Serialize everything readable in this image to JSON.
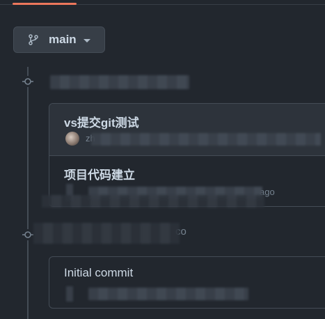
{
  "branch_selector": {
    "label": "main",
    "icon": "git-branch-icon"
  },
  "commit_groups": [
    {
      "heading": "",
      "commits": [
        {
          "title": "vs提交git测试",
          "author": "zh",
          "time_suffix": ""
        },
        {
          "title": "项目代码建立",
          "author": "",
          "time_suffix": "ago"
        }
      ]
    },
    {
      "heading": "co",
      "commits": [
        {
          "title": "Initial commit",
          "author": "",
          "time_suffix": ""
        }
      ]
    }
  ],
  "colors": {
    "background": "#22272e",
    "accent_underline": "#ec775c",
    "border": "#444c56",
    "text_primary": "#cdd9e5",
    "text_muted": "#768390"
  }
}
